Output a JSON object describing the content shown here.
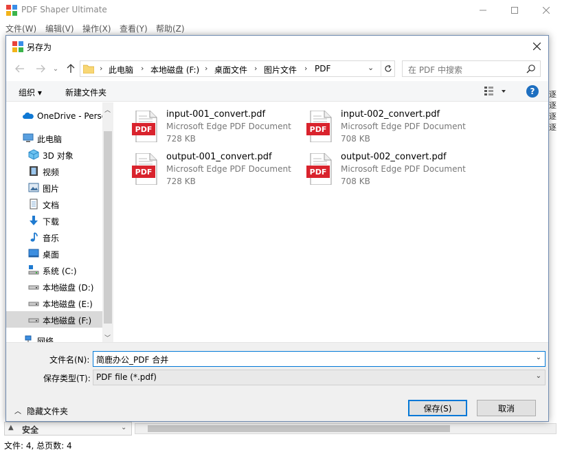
{
  "app": {
    "title": "PDF Shaper Ultimate",
    "menu": [
      "文件(W)",
      "编辑(V)",
      "操作(X)",
      "查看(Y)",
      "帮助(Z)"
    ],
    "status": "文件: 4, 总页数: 4",
    "bg_right_fragments": [
      "逐",
      "逐",
      "逐",
      "逐"
    ],
    "bg_security_label": "安全"
  },
  "dialog": {
    "title": "另存为",
    "address": {
      "segments": [
        "此电脑",
        "本地磁盘 (F:)",
        "桌面文件",
        "图片文件",
        "PDF"
      ]
    },
    "search": {
      "placeholder": "在 PDF 中搜索"
    },
    "toolbar": {
      "organize": "组织 ▾",
      "new_folder": "新建文件夹",
      "help": "?"
    },
    "nav_items": [
      {
        "label": "OneDrive - Perso",
        "icon": "onedrive-cloud-icon"
      },
      {
        "label": "此电脑",
        "icon": "this-pc-icon"
      },
      {
        "label": "3D 对象",
        "icon": "3d-objects-icon"
      },
      {
        "label": "视频",
        "icon": "videos-icon"
      },
      {
        "label": "图片",
        "icon": "pictures-icon"
      },
      {
        "label": "文档",
        "icon": "documents-icon"
      },
      {
        "label": "下载",
        "icon": "downloads-icon"
      },
      {
        "label": "音乐",
        "icon": "music-icon"
      },
      {
        "label": "桌面",
        "icon": "desktop-icon"
      },
      {
        "label": "系统 (C:)",
        "icon": "system-drive-icon"
      },
      {
        "label": "本地磁盘 (D:)",
        "icon": "drive-icon"
      },
      {
        "label": "本地磁盘 (E:)",
        "icon": "drive-icon"
      },
      {
        "label": "本地磁盘 (F:)",
        "icon": "drive-icon",
        "selected": true
      },
      {
        "label": "网络",
        "icon": "network-icon"
      }
    ],
    "files": [
      {
        "name": "input-001_convert.pdf",
        "type": "Microsoft Edge PDF Document",
        "size": "728 KB"
      },
      {
        "name": "input-002_convert.pdf",
        "type": "Microsoft Edge PDF Document",
        "size": "708 KB"
      },
      {
        "name": "output-001_convert.pdf",
        "type": "Microsoft Edge PDF Document",
        "size": "728 KB"
      },
      {
        "name": "output-002_convert.pdf",
        "type": "Microsoft Edge PDF Document",
        "size": "708 KB"
      }
    ],
    "pdf_icon_label": "PDF",
    "form": {
      "filename_label": "文件名(N):",
      "filename_value": "简鹿办公_PDF 合并",
      "filetype_label": "保存类型(T):",
      "filetype_value": "PDF file (*.pdf)",
      "hide_folders": "隐藏文件夹",
      "save": "保存(S)",
      "cancel": "取消"
    }
  },
  "colors": {
    "pdf_red": "#d9232d",
    "accent": "#0078d7",
    "help_blue": "#1e6fc0"
  }
}
